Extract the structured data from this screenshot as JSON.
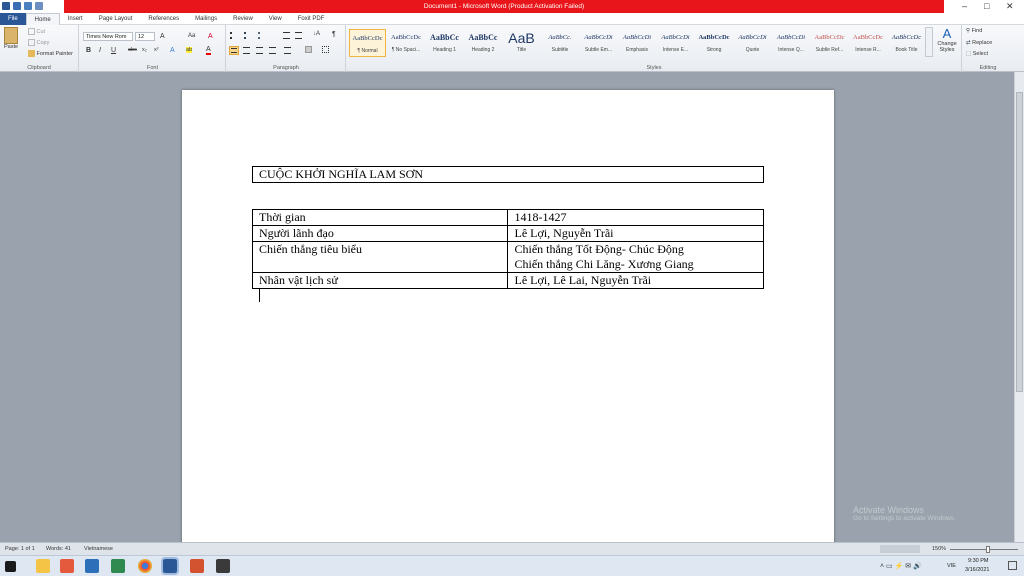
{
  "window": {
    "title": "Document1 - Microsoft Word (Product Activation Failed)",
    "minimize": "–",
    "maximize": "□",
    "close": "✕"
  },
  "tabs": [
    "File",
    "Home",
    "Insert",
    "Page Layout",
    "References",
    "Mailings",
    "Review",
    "View",
    "Foxit PDF"
  ],
  "clipboard": {
    "paste": "Paste",
    "cut": "Cut",
    "copy": "Copy",
    "format_painter": "Format Painter",
    "label": "Clipboard"
  },
  "font": {
    "name": "Times New Rom",
    "size": "12",
    "label": "Font",
    "bold": "B",
    "italic": "I",
    "underline": "U",
    "strike": "abc",
    "subscript": "x₂",
    "superscript": "x²",
    "grow": "A",
    "change_case": "Aa",
    "clear": "A",
    "highlight": "ab",
    "color": "A"
  },
  "paragraph": {
    "label": "Paragraph",
    "pilcrow": "¶"
  },
  "styles": {
    "label": "Styles",
    "items": [
      {
        "sample": "AaBbCcDc",
        "name": "¶ Normal"
      },
      {
        "sample": "AaBbCcDc",
        "name": "¶ No Spaci..."
      },
      {
        "sample": "AaBbCc",
        "name": "Heading 1"
      },
      {
        "sample": "AaBbCc",
        "name": "Heading 2"
      },
      {
        "sample": "AaB",
        "name": "Title"
      },
      {
        "sample": "AaBbCc.",
        "name": "Subtitle"
      },
      {
        "sample": "AaBbCcDi",
        "name": "Subtle Em..."
      },
      {
        "sample": "AaBbCcDi",
        "name": "Emphasis"
      },
      {
        "sample": "AaBbCcDi",
        "name": "Intense E..."
      },
      {
        "sample": "AaBbCcDc",
        "name": "Strong"
      },
      {
        "sample": "AaBbCcDi",
        "name": "Quote"
      },
      {
        "sample": "AaBbCcDi",
        "name": "Intense Q..."
      },
      {
        "sample": "AaBbCcDc",
        "name": "Subtle Ref..."
      },
      {
        "sample": "AaBbCcDc",
        "name": "Intense R..."
      },
      {
        "sample": "AaBbCcDc",
        "name": "Book Title"
      }
    ],
    "change_styles": "Change Styles"
  },
  "editing": {
    "find": "Find",
    "replace": "Replace",
    "select": "Select",
    "label": "Editing"
  },
  "document": {
    "heading_table": "CUỘC KHỞI NGHĨA LAM SƠN",
    "rows": [
      {
        "label": "Thời gian",
        "value": [
          "1418-1427"
        ]
      },
      {
        "label": "Người lãnh đạo",
        "value": [
          "Lê Lợi, Nguyễn Trãi"
        ]
      },
      {
        "label": "Chiến thắng tiêu biểu",
        "value": [
          "Chiến thắng Tốt Động- Chúc Động",
          "Chiến thắng Chi Lăng- Xương Giang"
        ]
      },
      {
        "label": "Nhân vật lịch sử",
        "value": [
          "Lê Lợi, Lê Lai, Nguyễn Trãi"
        ]
      }
    ]
  },
  "status": {
    "page": "Page: 1 of 1",
    "words": "Words: 41",
    "language": "Vietnamese",
    "zoom": "150%"
  },
  "watermark": {
    "title": "Activate Windows",
    "subtitle": "Go to Settings to activate Windows."
  },
  "taskbar": {
    "lang": "VIE",
    "time": "9:30 PM",
    "date": "3/16/2021"
  },
  "colors": {
    "title_bar": "#e8161a",
    "file_tab": "#2b5797",
    "style_heading": "#1f3864"
  }
}
